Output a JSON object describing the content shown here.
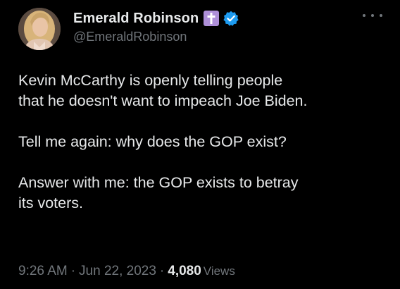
{
  "author": {
    "display_name": "Emerald Robinson",
    "handle": "@EmeraldRobinson",
    "avatar_icon": "user-avatar",
    "badges": [
      {
        "icon": "cross-icon",
        "color": "#ae8fd8"
      },
      {
        "icon": "verified-checkmark-icon",
        "color": "#1d9bf0"
      }
    ]
  },
  "menu": {
    "icon": "more-options-icon"
  },
  "tweet": {
    "paragraphs": [
      [
        "Kevin McCarthy is openly telling people",
        "that he doesn't want to impeach Joe Biden."
      ],
      [
        "Tell me again: why does the GOP exist?"
      ],
      [
        "Answer with me: the GOP exists to betray",
        "its voters."
      ]
    ]
  },
  "meta": {
    "time": "9:26 AM",
    "separator": "·",
    "date": "Jun 22, 2023",
    "views_count": "4,080",
    "views_label": "Views"
  },
  "colors": {
    "background": "#000000",
    "primary_text": "#e7e9ea",
    "secondary_text": "#71767b",
    "verified_blue": "#1d9bf0",
    "cross_badge": "#ae8fd8"
  }
}
